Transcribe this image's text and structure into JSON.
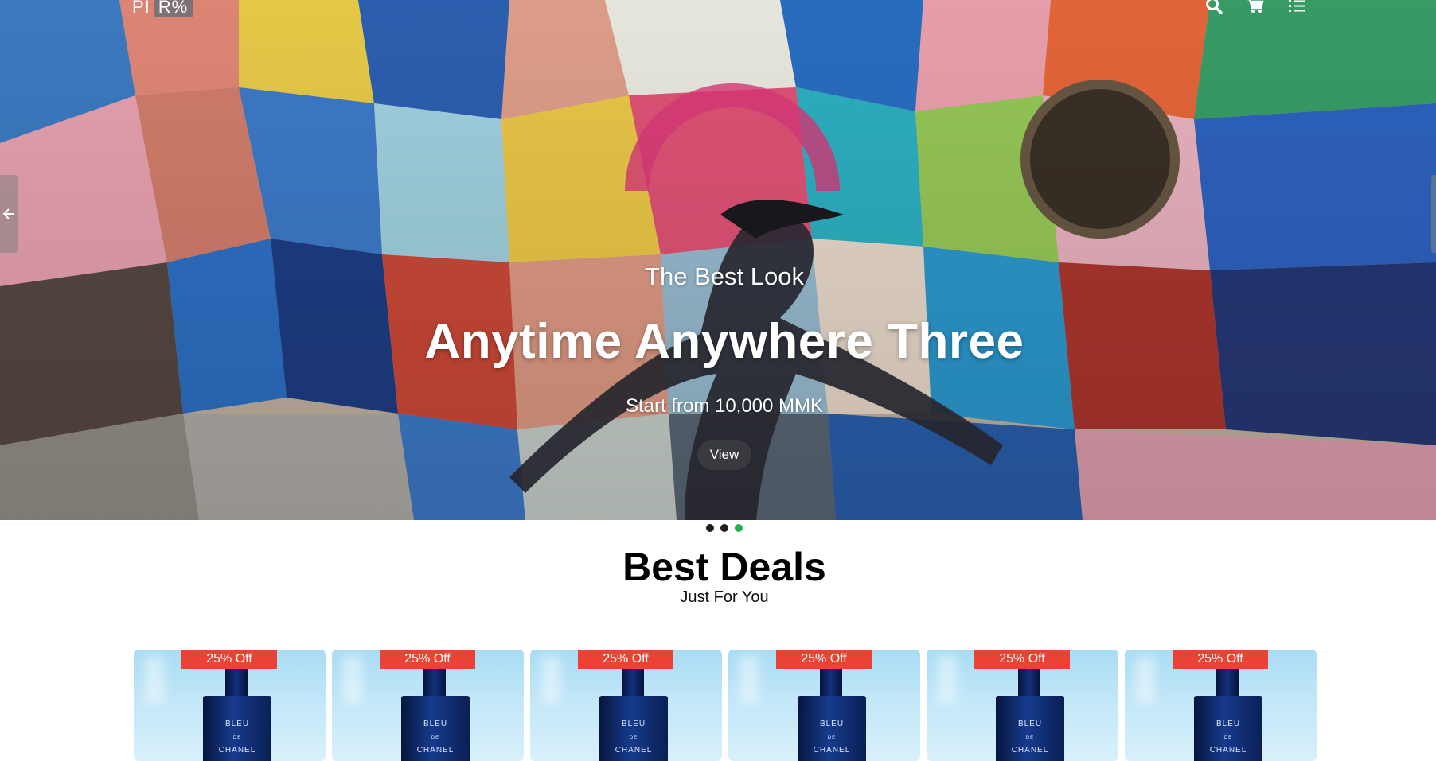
{
  "header": {
    "logo_left": "PI",
    "logo_right": "R%",
    "icons": [
      "search-icon",
      "cart-icon",
      "menu-list-icon"
    ]
  },
  "hero": {
    "subtitle": "The Best Look",
    "title": "Anytime Anywhere Three",
    "price_text": "Start from 10,000 MMK",
    "button_label": "View",
    "slides_total": 3,
    "active_slide": 3
  },
  "deals": {
    "title": "Best Deals",
    "subtitle": "Just For You",
    "products": [
      {
        "discount": "25% Off",
        "brand_line1": "BLEU",
        "brand_line2": "DE",
        "brand_line3": "CHANEL"
      },
      {
        "discount": "25% Off",
        "brand_line1": "BLEU",
        "brand_line2": "DE",
        "brand_line3": "CHANEL"
      },
      {
        "discount": "25% Off",
        "brand_line1": "BLEU",
        "brand_line2": "DE",
        "brand_line3": "CHANEL"
      },
      {
        "discount": "25% Off",
        "brand_line1": "BLEU",
        "brand_line2": "DE",
        "brand_line3": "CHANEL"
      },
      {
        "discount": "25% Off",
        "brand_line1": "BLEU",
        "brand_line2": "DE",
        "brand_line3": "CHANEL"
      },
      {
        "discount": "25% Off",
        "brand_line1": "BLEU",
        "brand_line2": "DE",
        "brand_line3": "CHANEL"
      }
    ]
  },
  "colors": {
    "badge": "#ea4335",
    "active_dot": "#22b24c",
    "inactive_dot": "#1d1d1d",
    "button_bg": "#3c3e44"
  }
}
